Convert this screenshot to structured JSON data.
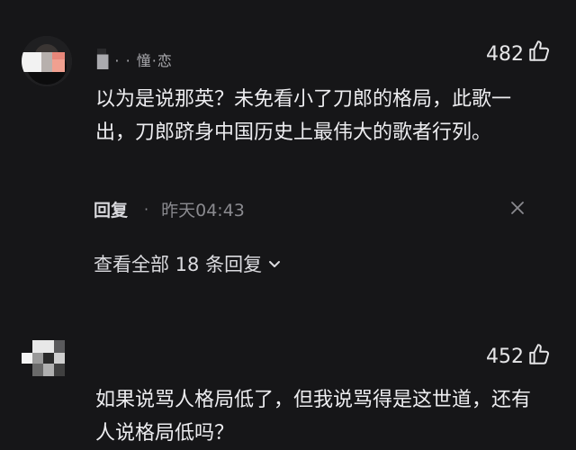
{
  "comments": [
    {
      "username": "▇    · · 憧·恋",
      "likes": "482",
      "text": "以为是说那英？未免看小了刀郎的格局，此歌一出，刀郎跻身中国历史上最伟大的歌者行列。",
      "reply_label": "回复",
      "separator": "·",
      "time": "昨天04:43",
      "view_replies_label": "查看全部 18 条回复",
      "icons": {
        "like": "thumbs-up-icon",
        "close": "close-icon",
        "chevron": "chevron-down-icon"
      }
    },
    {
      "likes": "452",
      "text": "如果说骂人格局低了，但我说骂得是这世道，还有人说格局低吗？",
      "icons": {
        "like": "thumbs-up-icon"
      }
    }
  ],
  "colors": {
    "background": "#161618",
    "text": "#ededf0",
    "muted": "#8a8a8f"
  }
}
